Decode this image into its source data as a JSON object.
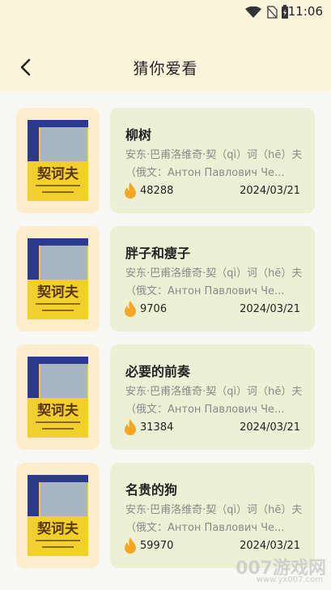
{
  "status": {
    "time": "11:06"
  },
  "header": {
    "title": "猜你爱看"
  },
  "colors": {
    "header_bg": "#fdf4dc",
    "cover_bg": "#fdeecb",
    "card_bg": "#ecf1d6",
    "fire": "#f5a623"
  },
  "items": [
    {
      "name": "柳树",
      "desc": "安东·巴甫洛维奇·契（qì）诃（hē）夫（俄文：Антон Павлович Че...",
      "count": "48288",
      "date": "2024/03/21",
      "cover_title": "契诃夫"
    },
    {
      "name": "胖子和瘦子",
      "desc": "安东·巴甫洛维奇·契（qì）诃（hē）夫（俄文：Антон Павлович Че...",
      "count": "9706",
      "date": "2024/03/21",
      "cover_title": "契诃夫"
    },
    {
      "name": "必要的前奏",
      "desc": "安东·巴甫洛维奇·契（qì）诃（hē）夫（俄文：Антон Павлович Че...",
      "count": "31384",
      "date": "2024/03/21",
      "cover_title": "契诃夫"
    },
    {
      "name": "名贵的狗",
      "desc": "安东·巴甫洛维奇·契（qì）诃（hē）夫（俄文：Антон Павлович Че...",
      "count": "59970",
      "date": "2024/03/21",
      "cover_title": "契诃夫"
    }
  ],
  "watermark": {
    "main": "007游戏网",
    "sub": "www.yx007.com"
  }
}
